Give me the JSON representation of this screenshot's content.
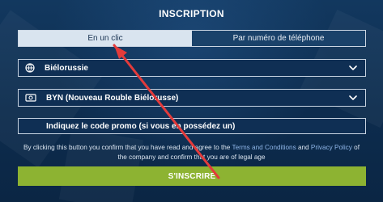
{
  "header": {
    "title": "INSCRIPTION"
  },
  "tabs": [
    {
      "label": "En un clic",
      "active": true
    },
    {
      "label": "Par numéro de téléphone",
      "active": false
    }
  ],
  "fields": {
    "country": {
      "icon": "globe-icon",
      "value": "Biélorussie"
    },
    "currency": {
      "icon": "money-icon",
      "value": "BYN (Nouveau Rouble Biélorusse)"
    },
    "promo": {
      "placeholder": "Indiquez le code promo (si vous en possédez un)"
    }
  },
  "terms": {
    "part1": "By clicking this button you confirm that you have read and agree to the ",
    "terms_link": "Terms and Conditions",
    "part2": " and ",
    "privacy_link": "Privacy Policy",
    "part3": " of the company and confirm that you are of legal age"
  },
  "actions": {
    "signup_label": "S'INSCRIRE"
  },
  "colors": {
    "background": "#0d2c4e",
    "tab_active": "#d9e4ef",
    "button": "#8db332",
    "link": "#8fb6e8",
    "annotation_arrow": "#e33b3b"
  }
}
